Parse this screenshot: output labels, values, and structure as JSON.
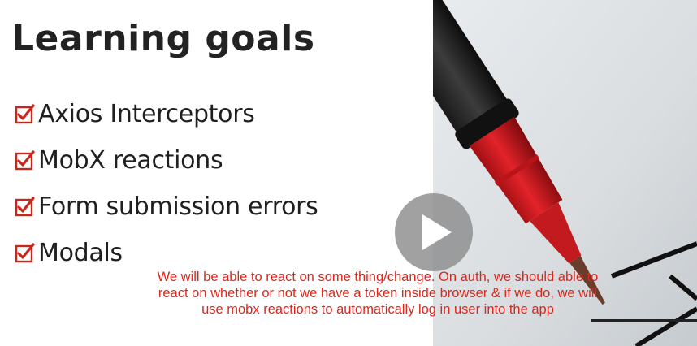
{
  "slide": {
    "title": "Learning goals",
    "goals": [
      {
        "label": "Axios Interceptors",
        "checked": true
      },
      {
        "label": "MobX reactions",
        "checked": true
      },
      {
        "label": "Form submission errors",
        "checked": true
      },
      {
        "label": "Modals",
        "checked": true
      }
    ],
    "check_icon": "checked-box-icon",
    "check_color": "#d62a1e"
  },
  "player": {
    "play_icon": "play-icon"
  },
  "caption": {
    "text": "We will be able to react on some thing/change. On auth, we should able to react on whether or not we have a token inside browser & if we do, we will use mobx reactions to automatically log in user into the app",
    "color": "#e0261b"
  }
}
